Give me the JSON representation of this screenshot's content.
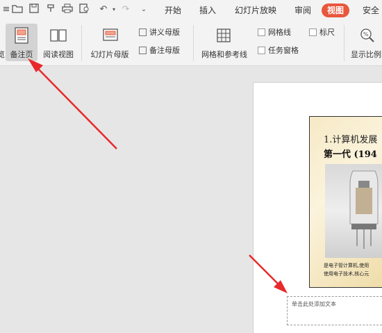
{
  "menu": {
    "tabs": [
      "开始",
      "插入",
      "幻灯片放映",
      "审阅",
      "视图",
      "安全"
    ],
    "active_tab": "视图"
  },
  "ribbon": {
    "partial_left": "览",
    "notes_page": "备注页",
    "reading_view": "阅读视图",
    "slide_master": "幻灯片母版",
    "handout_master": "讲义母版",
    "notes_master": "备注母版",
    "grid_guides": "网格和参考线",
    "gridlines": "网格线",
    "ruler": "标尺",
    "task_pane": "任务窗格",
    "zoom_partial": "显示比例"
  },
  "slide": {
    "title": "1.计算机发展",
    "subtitle": "第一代 (194",
    "caption_line1": "是电子管计算机,使用",
    "caption_line2": "使用电子技术,核心元"
  },
  "notes": {
    "placeholder": "单击此处添加文本"
  },
  "colors": {
    "accent": "#e8583d",
    "arrow": "#e8292b"
  }
}
